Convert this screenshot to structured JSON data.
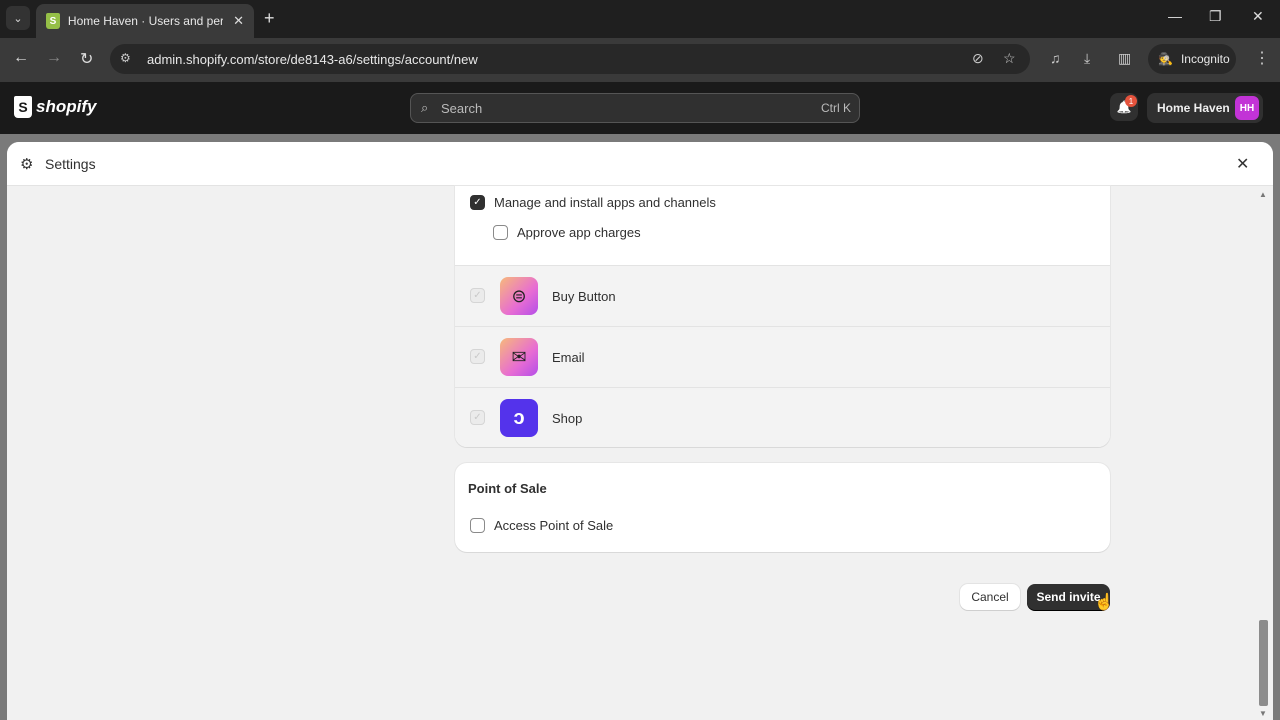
{
  "browser": {
    "tab_title": "Home Haven · Users and permi",
    "tab_close": "✕",
    "new_tab": "+",
    "url": "admin.shopify.com/store/de8143-a6/settings/account/new",
    "incognito_label": "Incognito",
    "window_controls": {
      "minimize": "—",
      "restore": "❐",
      "close": "✕"
    },
    "icons": {
      "back": "←",
      "forward": "→",
      "reload": "↻",
      "site_info": "⚙",
      "eye_off": "⊘",
      "star": "☆",
      "media": "♫",
      "download": "⤓",
      "sidepanel": "▥",
      "incognito": "🕵",
      "menu": "⋮",
      "tab_menu": "⌄"
    }
  },
  "shopify_bar": {
    "logo_text": "shopify",
    "logo_mark": "S",
    "search_placeholder": "Search",
    "search_shortcut": "Ctrl K",
    "notification_count": "1",
    "store_name": "Home Haven",
    "avatar_initials": "HH",
    "avatar_color": "#c233d6"
  },
  "modal": {
    "title": "Settings",
    "close": "✕",
    "permissions": {
      "manage_apps": {
        "label": "Manage and install apps and channels",
        "checked": true
      },
      "approve_charges": {
        "label": "Approve app charges",
        "checked": false
      }
    },
    "apps": [
      {
        "name": "Buy Button",
        "icon": "buy-button-icon",
        "checked": true,
        "disabled": true
      },
      {
        "name": "Email",
        "icon": "email-icon",
        "checked": true,
        "disabled": true
      },
      {
        "name": "Shop",
        "icon": "shop-icon",
        "checked": true,
        "disabled": true
      }
    ],
    "point_of_sale": {
      "title": "Point of Sale",
      "access": {
        "label": "Access Point of Sale",
        "checked": false
      }
    },
    "actions": {
      "cancel": "Cancel",
      "send_invite": "Send invite"
    }
  },
  "glyphs": {
    "check": "✓",
    "search": "⌕",
    "bell": "🔔",
    "gear": "⚙",
    "envelope": "✉",
    "shop": "ↄ",
    "buy": "⊜",
    "arrow_up": "▲",
    "arrow_down": "▼",
    "pointer": "☝"
  }
}
